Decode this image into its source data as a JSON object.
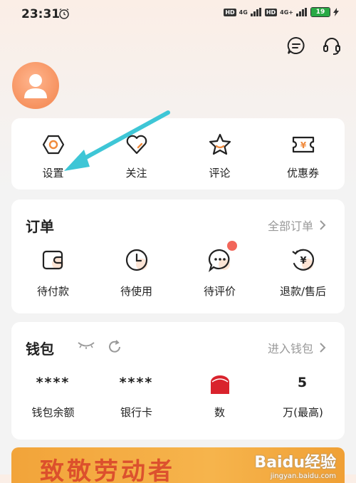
{
  "status": {
    "time": "23:31",
    "signal1": "4G",
    "signal2": "4G+",
    "hd": "HD",
    "battery": "19"
  },
  "quick_actions": [
    {
      "label": "设置",
      "icon": "hexagon-gear-icon"
    },
    {
      "label": "关注",
      "icon": "heart-icon"
    },
    {
      "label": "评论",
      "icon": "star-icon"
    },
    {
      "label": "优惠券",
      "icon": "coupon-icon"
    }
  ],
  "orders": {
    "title": "订单",
    "all_link": "全部订单",
    "items": [
      {
        "label": "待付款",
        "icon": "wallet-icon"
      },
      {
        "label": "待使用",
        "icon": "clock-icon"
      },
      {
        "label": "待评价",
        "icon": "chat-bubble-icon"
      },
      {
        "label": "退款/售后",
        "icon": "refund-icon"
      }
    ]
  },
  "wallet": {
    "title": "钱包",
    "enter_link": "进入钱包",
    "items": [
      {
        "value": "****",
        "label": "钱包余额"
      },
      {
        "value": "****",
        "label": "银行卡"
      },
      {
        "value": "",
        "label": "数"
      },
      {
        "value": "5",
        "label": "万(最高)"
      }
    ]
  },
  "banner": {
    "text": "致敬劳动者"
  },
  "watermark": {
    "brand": "Baidu经验",
    "url": "jingyan.baidu.com"
  },
  "colors": {
    "accent": "#f6925f",
    "arrow": "#3ec6d6",
    "brand_orange": "#f08a3c"
  }
}
